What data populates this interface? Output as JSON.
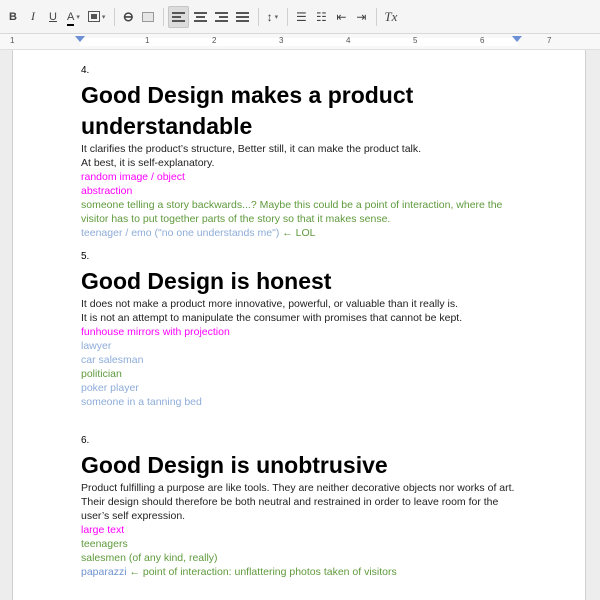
{
  "toolbar": {
    "bold": "B",
    "italic": "I",
    "underline": "U",
    "text_color": "A",
    "highlight_caret": "▾",
    "text_color_caret": "▾",
    "link_glyph": "⊖",
    "line_spacing_glyph": "↕",
    "line_spacing_caret": "▾",
    "numbered_list_glyph": "☰",
    "bulleted_list_glyph": "☷",
    "decrease_indent_glyph": "⇤",
    "increase_indent_glyph": "⇥",
    "clear_format_glyph": "Tx"
  },
  "ruler": {
    "labels": [
      "1",
      "1",
      "2",
      "3",
      "4",
      "5",
      "6",
      "7"
    ]
  },
  "document": {
    "sections": [
      {
        "number": "4.",
        "heading_line1": "Good Design makes a product",
        "heading_line2": "understandable",
        "body1": "It clarifies the product’s structure, Better still, it can make the product talk.",
        "body2": "At best, it is self-explanatory.",
        "notes": [
          {
            "text": "random image / object",
            "color": "#ff00ff"
          },
          {
            "text": "abstraction",
            "color": "#ff00ff"
          },
          {
            "text": "someone telling a story backwards...? Maybe this could be a point of interaction, where the",
            "color": "#5f9a3c"
          },
          {
            "text": "visitor has to put together parts of the story so that it makes sense.",
            "color": "#5f9a3c"
          }
        ],
        "last_blue": "teenager / emo (\"no one understands me\")",
        "last_green": " ← LOL"
      },
      {
        "number": "5.",
        "heading": "Good Design is honest",
        "body1": "It does not make a product more innovative, powerful, or valuable than it really is.",
        "body2": "It is not an attempt to manipulate the consumer with promises that cannot be kept.",
        "notes": [
          {
            "text": "funhouse mirrors with projection",
            "color": "#ff00ff"
          },
          {
            "text": "lawyer",
            "color": "#8eacd9"
          },
          {
            "text": "car salesman",
            "color": "#8eacd9"
          },
          {
            "text": "politician",
            "color": "#5f9a3c"
          },
          {
            "text": "poker player",
            "color": "#8eacd9"
          },
          {
            "text": "someone in a tanning bed",
            "color": "#8eacd9"
          }
        ]
      },
      {
        "number": "6.",
        "heading": "Good Design is unobtrusive",
        "body1": "Product fulfilling a purpose are like tools. They are neither decorative objects nor works of art.",
        "body2": "Their design should therefore be both neutral and restrained in order to leave room for the",
        "body3": "user’s self expression.",
        "notes": [
          {
            "text": "large text",
            "color": "#ff00ff"
          },
          {
            "text": "teenagers",
            "color": "#5f9a3c"
          },
          {
            "text": "salesmen (of any kind, really)",
            "color": "#5f9a3c"
          }
        ],
        "last_blue": "paparazzi",
        "last_green": " ← point of interaction: unflattering photos taken of visitors"
      }
    ]
  }
}
